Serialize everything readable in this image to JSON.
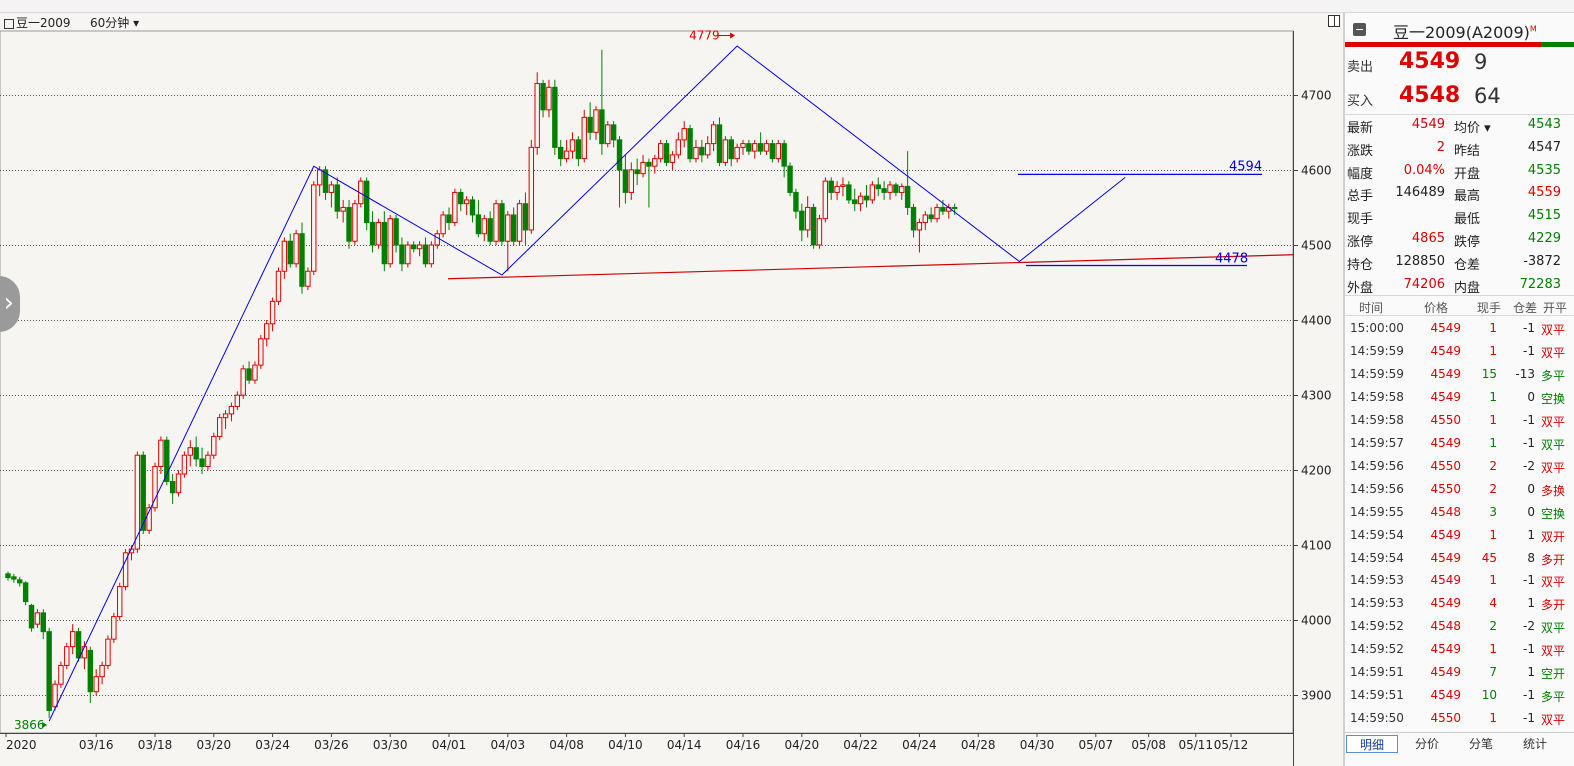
{
  "chart_header": {
    "symbol": "豆一2009",
    "period": "60分钟"
  },
  "chart_data": {
    "type": "candlestick",
    "ylim": [
      3850,
      4785
    ],
    "y_ticks": [
      3900,
      4000,
      4100,
      4200,
      4300,
      4400,
      4500,
      4600,
      4700
    ],
    "x_labels": [
      "2020",
      "03/16",
      "03/18",
      "03/20",
      "03/24",
      "03/26",
      "03/30",
      "04/01",
      "04/03",
      "04/08",
      "04/10",
      "04/14",
      "04/16",
      "04/20",
      "04/22",
      "04/24",
      "04/28",
      "04/30",
      "05/07",
      "05/08",
      "05/11",
      "05/12"
    ],
    "x_label_positions": [
      0,
      15,
      25,
      35,
      45,
      55,
      65,
      75,
      85,
      95,
      105,
      115,
      125,
      135,
      145,
      155,
      165,
      175,
      185,
      194,
      202,
      208
    ],
    "ohlc": [
      [
        4062,
        4065,
        4053,
        4057
      ],
      [
        4058,
        4062,
        4050,
        4055
      ],
      [
        4054,
        4058,
        4045,
        4050
      ],
      [
        4050,
        4052,
        4020,
        4025
      ],
      [
        4020,
        4022,
        3985,
        3990
      ],
      [
        3995,
        4015,
        3990,
        4010
      ],
      [
        4010,
        4015,
        3975,
        3985
      ],
      [
        3985,
        3990,
        3870,
        3880
      ],
      [
        3885,
        3920,
        3880,
        3915
      ],
      [
        3915,
        3945,
        3910,
        3940
      ],
      [
        3940,
        3970,
        3935,
        3965
      ],
      [
        3965,
        3995,
        3955,
        3985
      ],
      [
        3985,
        3990,
        3945,
        3950
      ],
      [
        3950,
        3972,
        3935,
        3965
      ],
      [
        3960,
        3965,
        3890,
        3905
      ],
      [
        3905,
        3935,
        3900,
        3925
      ],
      [
        3925,
        3945,
        3915,
        3940
      ],
      [
        3940,
        3980,
        3935,
        3975
      ],
      [
        3975,
        4010,
        3970,
        4005
      ],
      [
        4005,
        4050,
        4000,
        4045
      ],
      [
        4045,
        4095,
        4040,
        4090
      ],
      [
        4090,
        4100,
        4080,
        4095
      ],
      [
        4095,
        4225,
        4090,
        4220
      ],
      [
        4220,
        4225,
        4115,
        4120
      ],
      [
        4120,
        4155,
        4115,
        4150
      ],
      [
        4150,
        4210,
        4145,
        4205
      ],
      [
        4205,
        4245,
        4195,
        4240
      ],
      [
        4240,
        4245,
        4180,
        4185
      ],
      [
        4185,
        4195,
        4155,
        4170
      ],
      [
        4170,
        4200,
        4165,
        4195
      ],
      [
        4195,
        4225,
        4190,
        4220
      ],
      [
        4220,
        4240,
        4205,
        4230
      ],
      [
        4230,
        4245,
        4205,
        4215
      ],
      [
        4215,
        4230,
        4195,
        4205
      ],
      [
        4205,
        4225,
        4200,
        4220
      ],
      [
        4220,
        4250,
        4215,
        4245
      ],
      [
        4245,
        4275,
        4240,
        4270
      ],
      [
        4270,
        4280,
        4255,
        4275
      ],
      [
        4275,
        4290,
        4265,
        4285
      ],
      [
        4285,
        4305,
        4280,
        4300
      ],
      [
        4300,
        4340,
        4295,
        4335
      ],
      [
        4335,
        4345,
        4315,
        4320
      ],
      [
        4320,
        4345,
        4315,
        4340
      ],
      [
        4340,
        4380,
        4335,
        4375
      ],
      [
        4375,
        4400,
        4365,
        4395
      ],
      [
        4395,
        4430,
        4385,
        4425
      ],
      [
        4425,
        4470,
        4420,
        4465
      ],
      [
        4465,
        4510,
        4455,
        4505
      ],
      [
        4505,
        4515,
        4470,
        4475
      ],
      [
        4475,
        4520,
        4470,
        4515
      ],
      [
        4515,
        4530,
        4435,
        4445
      ],
      [
        4445,
        4470,
        4440,
        4465
      ],
      [
        4465,
        4585,
        4460,
        4580
      ],
      [
        4580,
        4605,
        4565,
        4600
      ],
      [
        4600,
        4605,
        4560,
        4570
      ],
      [
        4570,
        4585,
        4550,
        4580
      ],
      [
        4580,
        4590,
        4535,
        4545
      ],
      [
        4545,
        4560,
        4530,
        4550
      ],
      [
        4550,
        4560,
        4495,
        4505
      ],
      [
        4505,
        4560,
        4500,
        4555
      ],
      [
        4555,
        4590,
        4550,
        4585
      ],
      [
        4585,
        4590,
        4520,
        4530
      ],
      [
        4530,
        4545,
        4490,
        4500
      ],
      [
        4500,
        4535,
        4495,
        4530
      ],
      [
        4530,
        4545,
        4465,
        4475
      ],
      [
        4475,
        4540,
        4470,
        4535
      ],
      [
        4535,
        4540,
        4490,
        4500
      ],
      [
        4500,
        4510,
        4465,
        4475
      ],
      [
        4475,
        4505,
        4470,
        4500
      ],
      [
        4500,
        4505,
        4490,
        4495
      ],
      [
        4495,
        4505,
        4485,
        4500
      ],
      [
        4500,
        4510,
        4470,
        4475
      ],
      [
        4475,
        4505,
        4470,
        4500
      ],
      [
        4500,
        4520,
        4495,
        4515
      ],
      [
        4515,
        4545,
        4510,
        4540
      ],
      [
        4540,
        4550,
        4520,
        4530
      ],
      [
        4530,
        4575,
        4525,
        4570
      ],
      [
        4570,
        4575,
        4545,
        4555
      ],
      [
        4555,
        4565,
        4540,
        4560
      ],
      [
        4560,
        4565,
        4530,
        4540
      ],
      [
        4540,
        4560,
        4510,
        4515
      ],
      [
        4515,
        4540,
        4505,
        4535
      ],
      [
        4535,
        4545,
        4500,
        4505
      ],
      [
        4505,
        4560,
        4500,
        4555
      ],
      [
        4555,
        4560,
        4500,
        4505
      ],
      [
        4505,
        4545,
        4465,
        4540
      ],
      [
        4540,
        4550,
        4500,
        4505
      ],
      [
        4505,
        4560,
        4500,
        4555
      ],
      [
        4555,
        4570,
        4500,
        4520
      ],
      [
        4520,
        4640,
        4515,
        4630
      ],
      [
        4630,
        4730,
        4620,
        4715
      ],
      [
        4715,
        4720,
        4670,
        4680
      ],
      [
        4680,
        4720,
        4670,
        4710
      ],
      [
        4710,
        4720,
        4620,
        4630
      ],
      [
        4630,
        4640,
        4605,
        4615
      ],
      [
        4615,
        4640,
        4610,
        4625
      ],
      [
        4625,
        4650,
        4615,
        4640
      ],
      [
        4640,
        4645,
        4605,
        4615
      ],
      [
        4615,
        4680,
        4610,
        4670
      ],
      [
        4670,
        4690,
        4640,
        4650
      ],
      [
        4650,
        4685,
        4640,
        4680
      ],
      [
        4680,
        4760,
        4620,
        4635
      ],
      [
        4635,
        4665,
        4630,
        4660
      ],
      [
        4660,
        4665,
        4630,
        4640
      ],
      [
        4640,
        4645,
        4550,
        4600
      ],
      [
        4600,
        4620,
        4555,
        4570
      ],
      [
        4570,
        4610,
        4560,
        4600
      ],
      [
        4600,
        4615,
        4580,
        4595
      ],
      [
        4595,
        4620,
        4590,
        4610
      ],
      [
        4610,
        4615,
        4550,
        4605
      ],
      [
        4605,
        4620,
        4595,
        4615
      ],
      [
        4615,
        4640,
        4610,
        4635
      ],
      [
        4635,
        4640,
        4605,
        4610
      ],
      [
        4610,
        4625,
        4600,
        4620
      ],
      [
        4620,
        4650,
        4615,
        4640
      ],
      [
        4640,
        4665,
        4630,
        4655
      ],
      [
        4655,
        4660,
        4610,
        4615
      ],
      [
        4615,
        4640,
        4610,
        4630
      ],
      [
        4630,
        4640,
        4610,
        4620
      ],
      [
        4620,
        4645,
        4615,
        4635
      ],
      [
        4635,
        4665,
        4625,
        4660
      ],
      [
        4660,
        4670,
        4605,
        4610
      ],
      [
        4610,
        4645,
        4605,
        4640
      ],
      [
        4640,
        4645,
        4605,
        4615
      ],
      [
        4615,
        4635,
        4610,
        4630
      ],
      [
        4630,
        4640,
        4620,
        4635
      ],
      [
        4635,
        4640,
        4620,
        4625
      ],
      [
        4625,
        4640,
        4615,
        4635
      ],
      [
        4635,
        4650,
        4620,
        4625
      ],
      [
        4625,
        4640,
        4620,
        4635
      ],
      [
        4635,
        4640,
        4610,
        4615
      ],
      [
        4615,
        4640,
        4610,
        4635
      ],
      [
        4635,
        4640,
        4590,
        4605
      ],
      [
        4605,
        4610,
        4565,
        4570
      ],
      [
        4570,
        4575,
        4535,
        4545
      ],
      [
        4545,
        4555,
        4505,
        4520
      ],
      [
        4520,
        4565,
        4510,
        4550
      ],
      [
        4550,
        4555,
        4495,
        4500
      ],
      [
        4500,
        4540,
        4495,
        4535
      ],
      [
        4535,
        4590,
        4530,
        4585
      ],
      [
        4585,
        4590,
        4560,
        4570
      ],
      [
        4570,
        4585,
        4560,
        4578
      ],
      [
        4578,
        4590,
        4565,
        4580
      ],
      [
        4580,
        4585,
        4555,
        4560
      ],
      [
        4560,
        4575,
        4545,
        4555
      ],
      [
        4555,
        4570,
        4545,
        4565
      ],
      [
        4565,
        4580,
        4550,
        4560
      ],
      [
        4560,
        4585,
        4555,
        4580
      ],
      [
        4580,
        4590,
        4565,
        4575
      ],
      [
        4575,
        4585,
        4560,
        4570
      ],
      [
        4570,
        4585,
        4560,
        4580
      ],
      [
        4580,
        4583,
        4565,
        4570
      ],
      [
        4570,
        4582,
        4560,
        4578
      ],
      [
        4578,
        4625,
        4540,
        4550
      ],
      [
        4550,
        4555,
        4510,
        4520
      ],
      [
        4520,
        4535,
        4490,
        4530
      ],
      [
        4530,
        4545,
        4520,
        4540
      ],
      [
        4540,
        4550,
        4530,
        4535
      ],
      [
        4535,
        4555,
        4530,
        4550
      ],
      [
        4550,
        4560,
        4540,
        4545
      ],
      [
        4545,
        4555,
        4535,
        4550
      ],
      [
        4550,
        4555,
        4540,
        4549
      ]
    ],
    "zigzag": [
      [
        7,
        3866
      ],
      [
        52,
        4605
      ],
      [
        84,
        4460
      ],
      [
        124,
        4765
      ],
      [
        172,
        4478
      ],
      [
        190,
        4590
      ]
    ],
    "annotations": [
      {
        "text": "4779",
        "bar": 124,
        "price": 4779,
        "color": "#e00000"
      },
      {
        "text": "3866",
        "bar": 7,
        "price": 3866,
        "color": "#008000"
      },
      {
        "text": "4594",
        "price": 4594,
        "color": "#0000ee"
      },
      {
        "text": "4478",
        "price": 4478,
        "color": "#0000ee"
      }
    ]
  },
  "quote": {
    "title": "豆一2009(A2009)",
    "title_sup": "M",
    "sell_label": "卖出",
    "sell_price": "4549",
    "sell_vol": "9",
    "buy_label": "买入",
    "buy_price": "4548",
    "buy_vol": "64",
    "stats": [
      {
        "l1": "最新",
        "v1": "4549",
        "c1": "red",
        "l2": "均价 ▾",
        "v2": "4543",
        "c2": "green"
      },
      {
        "l1": "涨跌",
        "v1": "2",
        "c1": "red",
        "l2": "昨结",
        "v2": "4547",
        "c2": "blk"
      },
      {
        "l1": "幅度",
        "v1": "0.04%",
        "c1": "red",
        "l2": "开盘",
        "v2": "4535",
        "c2": "green"
      },
      {
        "l1": "总手",
        "v1": "146489",
        "c1": "blk",
        "l2": "最高",
        "v2": "4559",
        "c2": "red"
      },
      {
        "l1": "现手",
        "v1": "",
        "c1": "blk",
        "l2": "最低",
        "v2": "4515",
        "c2": "green"
      },
      {
        "l1": "涨停",
        "v1": "4865",
        "c1": "red",
        "l2": "跌停",
        "v2": "4229",
        "c2": "green"
      },
      {
        "l1": "持仓",
        "v1": "128850",
        "c1": "blk",
        "l2": "仓差",
        "v2": "-3872",
        "c2": "blk"
      },
      {
        "l1": "外盘",
        "v1": "74206",
        "c1": "red",
        "l2": "内盘",
        "v2": "72283",
        "c2": "green"
      }
    ],
    "ticks_header": [
      "时间",
      "价格",
      "现手",
      "仓差",
      "开平"
    ],
    "ticks": [
      {
        "t": "15:00:00",
        "p": "4549",
        "pc": "red",
        "v": "1",
        "vc": "red",
        "oi": "-1",
        "type": "双平",
        "tc": "red"
      },
      {
        "t": "14:59:59",
        "p": "4549",
        "pc": "red",
        "v": "1",
        "vc": "red",
        "oi": "-1",
        "type": "双平",
        "tc": "red"
      },
      {
        "t": "14:59:59",
        "p": "4549",
        "pc": "red",
        "v": "15",
        "vc": "green",
        "oi": "-13",
        "type": "多平",
        "tc": "green"
      },
      {
        "t": "14:59:58",
        "p": "4549",
        "pc": "red",
        "v": "1",
        "vc": "green",
        "oi": "0",
        "type": "空换",
        "tc": "green"
      },
      {
        "t": "14:59:58",
        "p": "4550",
        "pc": "red",
        "v": "1",
        "vc": "red",
        "oi": "-1",
        "type": "双平",
        "tc": "red"
      },
      {
        "t": "14:59:57",
        "p": "4549",
        "pc": "red",
        "v": "1",
        "vc": "green",
        "oi": "-1",
        "type": "双平",
        "tc": "green"
      },
      {
        "t": "14:59:56",
        "p": "4550",
        "pc": "red",
        "v": "2",
        "vc": "red",
        "oi": "-2",
        "type": "双平",
        "tc": "red"
      },
      {
        "t": "14:59:56",
        "p": "4550",
        "pc": "red",
        "v": "2",
        "vc": "red",
        "oi": "0",
        "type": "多换",
        "tc": "red"
      },
      {
        "t": "14:59:55",
        "p": "4548",
        "pc": "red",
        "v": "3",
        "vc": "green",
        "oi": "0",
        "type": "空换",
        "tc": "green"
      },
      {
        "t": "14:59:54",
        "p": "4549",
        "pc": "red",
        "v": "1",
        "vc": "red",
        "oi": "1",
        "type": "双开",
        "tc": "red"
      },
      {
        "t": "14:59:54",
        "p": "4549",
        "pc": "red",
        "v": "45",
        "vc": "red",
        "oi": "8",
        "type": "多开",
        "tc": "red"
      },
      {
        "t": "14:59:53",
        "p": "4549",
        "pc": "red",
        "v": "1",
        "vc": "red",
        "oi": "-1",
        "type": "双平",
        "tc": "red"
      },
      {
        "t": "14:59:53",
        "p": "4549",
        "pc": "red",
        "v": "4",
        "vc": "red",
        "oi": "1",
        "type": "多开",
        "tc": "red"
      },
      {
        "t": "14:59:52",
        "p": "4548",
        "pc": "red",
        "v": "2",
        "vc": "green",
        "oi": "-2",
        "type": "双平",
        "tc": "green"
      },
      {
        "t": "14:59:52",
        "p": "4549",
        "pc": "red",
        "v": "1",
        "vc": "red",
        "oi": "-1",
        "type": "双平",
        "tc": "red"
      },
      {
        "t": "14:59:51",
        "p": "4549",
        "pc": "red",
        "v": "7",
        "vc": "green",
        "oi": "1",
        "type": "空开",
        "tc": "green"
      },
      {
        "t": "14:59:51",
        "p": "4549",
        "pc": "red",
        "v": "10",
        "vc": "green",
        "oi": "-1",
        "type": "多平",
        "tc": "green"
      },
      {
        "t": "14:59:50",
        "p": "4550",
        "pc": "red",
        "v": "1",
        "vc": "red",
        "oi": "-1",
        "type": "双平",
        "tc": "red"
      }
    ],
    "tabs": [
      "明细",
      "分价",
      "分笔",
      "统计"
    ]
  },
  "colors": {
    "up": "#e00000",
    "down": "#008000",
    "line": "#0000ee",
    "support": "#d00000"
  }
}
